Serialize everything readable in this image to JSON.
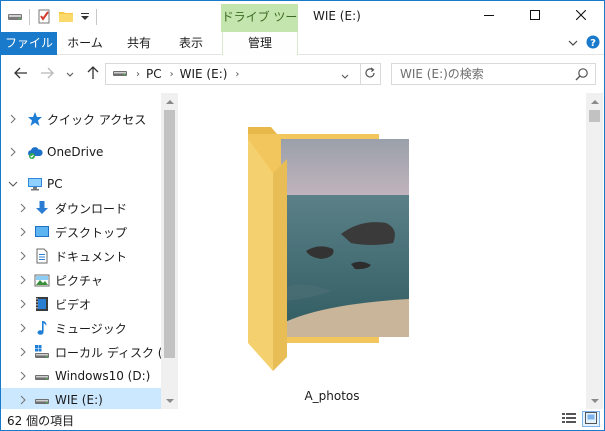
{
  "titlebar": {
    "context_tab": "ドライブ ツール",
    "title": "WIE (E:)"
  },
  "ribbon": {
    "tabs": [
      "ファイル",
      "ホーム",
      "共有",
      "表示",
      "管理"
    ]
  },
  "address": {
    "crumbs": [
      "PC",
      "WIE (E:)"
    ],
    "search_placeholder": "WIE (E:)の検索"
  },
  "nav": {
    "items": [
      {
        "label": "クイック アクセス",
        "icon": "star-icon"
      },
      {
        "label": "OneDrive",
        "icon": "onedrive-cloud-icon"
      },
      {
        "label": "PC",
        "icon": "pc-icon"
      },
      {
        "label": "ダウンロード",
        "icon": "download-arrow-icon"
      },
      {
        "label": "デスクトップ",
        "icon": "desktop-icon"
      },
      {
        "label": "ドキュメント",
        "icon": "document-icon"
      },
      {
        "label": "ピクチャ",
        "icon": "pictures-icon"
      },
      {
        "label": "ビデオ",
        "icon": "video-icon"
      },
      {
        "label": "ミュージック",
        "icon": "music-note-icon"
      },
      {
        "label": "ローカル ディスク (C:)",
        "icon": "windows-drive-icon"
      },
      {
        "label": "Windows10 (D:)",
        "icon": "drive-icon"
      },
      {
        "label": "WIE (E:)",
        "icon": "drive-icon"
      }
    ]
  },
  "content": {
    "folder_name": "A_photos"
  },
  "status": {
    "item_count": "62 個の項目"
  },
  "colors": {
    "accent": "#1979ca",
    "context_tab_bg": "#c4e5ae",
    "selection": "#cce8ff",
    "folder": "#f5d06f"
  }
}
